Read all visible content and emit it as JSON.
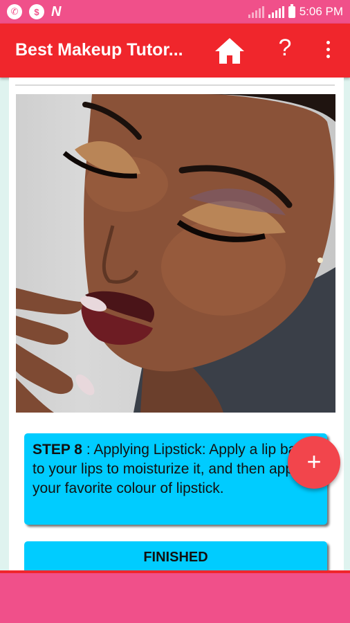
{
  "status_bar": {
    "time": "5:06 PM",
    "icons": [
      "whatsapp-icon",
      "dollar-circle-icon",
      "n-app-icon",
      "signal-icon",
      "signal-icon",
      "battery-icon"
    ]
  },
  "toolbar": {
    "title": "Best Makeup Tutor...",
    "help_label": "?",
    "icons": [
      "home-icon",
      "help-icon",
      "more-vert-icon"
    ]
  },
  "step": {
    "label": "STEP 8",
    "text": " : Applying Lipstick: Apply a lip balm to your lips to moisturize it, and then apply your favorite colour of lipstick."
  },
  "finish_button": {
    "label": "FINISHED"
  },
  "fab": {
    "label": "+"
  },
  "colors": {
    "status_bar": "#f0508a",
    "toolbar": "#f0262c",
    "card": "#00ccff",
    "fab": "#f2454c",
    "background": "#dff3ef"
  }
}
